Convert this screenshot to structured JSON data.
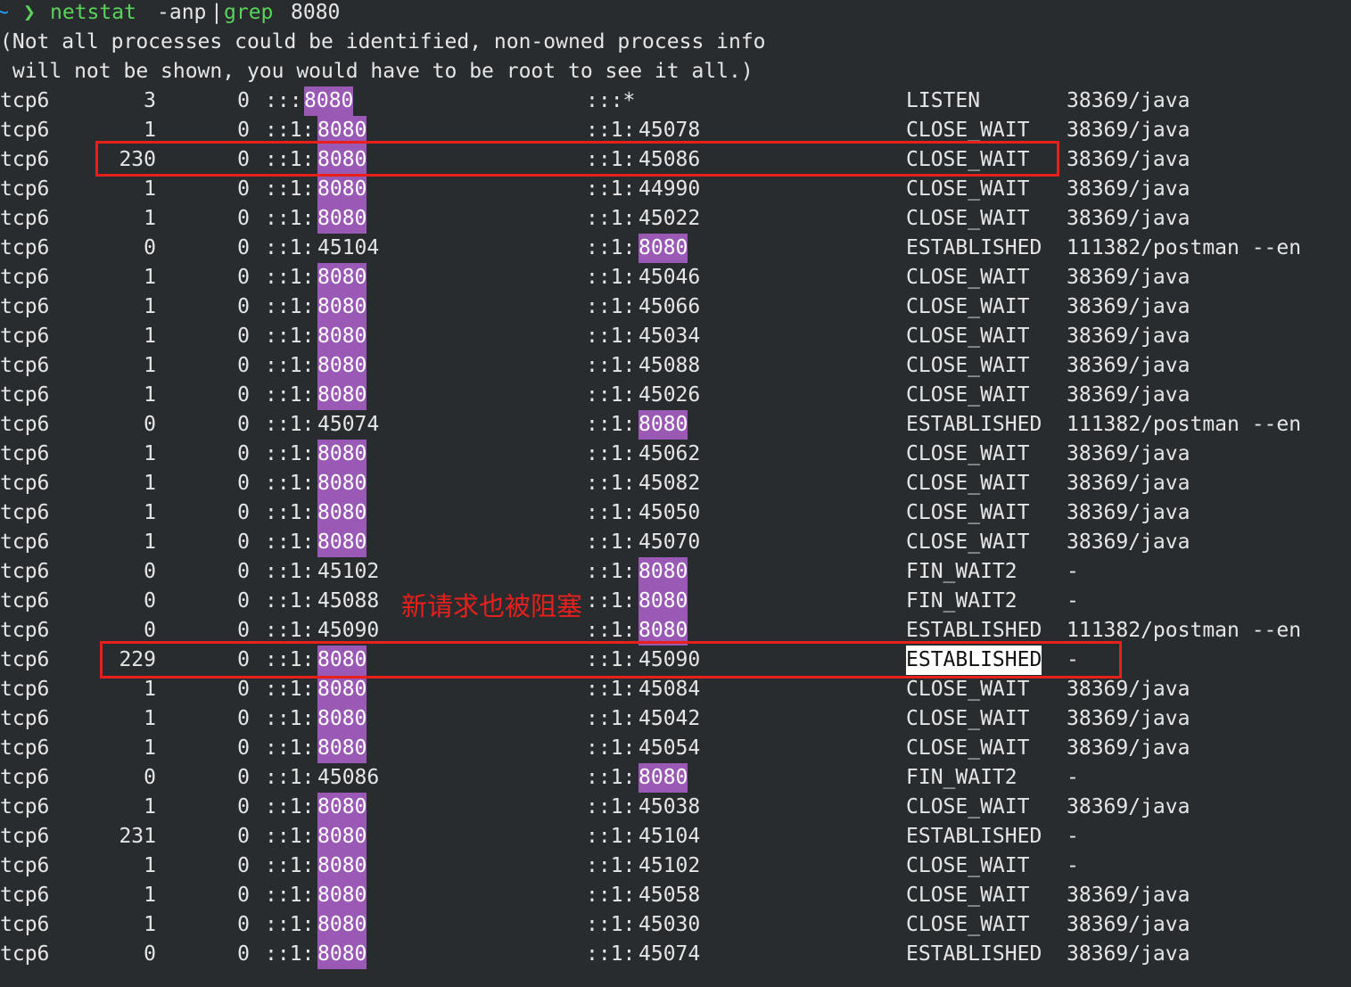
{
  "command": {
    "prompt_icon": "~",
    "prompt_chevron": "❯",
    "cmd": "netstat",
    "args": "-anp",
    "pipe": "|",
    "grep": "grep",
    "pattern": "8080"
  },
  "warning": [
    "(Not all processes could be identified, non-owned process info",
    " will not be shown, you would have to be root to see it all.)"
  ],
  "rows": [
    {
      "proto": "tcp6",
      "recv": "3",
      "send": "0",
      "local_prefix": ":::",
      "local_port": "8080",
      "local_hl": true,
      "foreign_prefix": ":::*",
      "foreign_port": "",
      "foreign_hl": false,
      "state": "LISTEN",
      "pid": "38369/java"
    },
    {
      "proto": "tcp6",
      "recv": "1",
      "send": "0",
      "local_prefix": "::1:",
      "local_port": "8080",
      "local_hl": true,
      "foreign_prefix": "::1:",
      "foreign_port": "45078",
      "foreign_hl": false,
      "state": "CLOSE_WAIT",
      "pid": "38369/java"
    },
    {
      "proto": "tcp6",
      "recv": "230",
      "send": "0",
      "local_prefix": "::1:",
      "local_port": "8080",
      "local_hl": true,
      "foreign_prefix": "::1:",
      "foreign_port": "45086",
      "foreign_hl": false,
      "state": "CLOSE_WAIT",
      "pid": "38369/java"
    },
    {
      "proto": "tcp6",
      "recv": "1",
      "send": "0",
      "local_prefix": "::1:",
      "local_port": "8080",
      "local_hl": true,
      "foreign_prefix": "::1:",
      "foreign_port": "44990",
      "foreign_hl": false,
      "state": "CLOSE_WAIT",
      "pid": "38369/java"
    },
    {
      "proto": "tcp6",
      "recv": "1",
      "send": "0",
      "local_prefix": "::1:",
      "local_port": "8080",
      "local_hl": true,
      "foreign_prefix": "::1:",
      "foreign_port": "45022",
      "foreign_hl": false,
      "state": "CLOSE_WAIT",
      "pid": "38369/java"
    },
    {
      "proto": "tcp6",
      "recv": "0",
      "send": "0",
      "local_prefix": "::1:",
      "local_port": "45104",
      "local_hl": false,
      "foreign_prefix": "::1:",
      "foreign_port": "8080",
      "foreign_hl": true,
      "state": "ESTABLISHED",
      "pid": "111382/postman --en"
    },
    {
      "proto": "tcp6",
      "recv": "1",
      "send": "0",
      "local_prefix": "::1:",
      "local_port": "8080",
      "local_hl": true,
      "foreign_prefix": "::1:",
      "foreign_port": "45046",
      "foreign_hl": false,
      "state": "CLOSE_WAIT",
      "pid": "38369/java"
    },
    {
      "proto": "tcp6",
      "recv": "1",
      "send": "0",
      "local_prefix": "::1:",
      "local_port": "8080",
      "local_hl": true,
      "foreign_prefix": "::1:",
      "foreign_port": "45066",
      "foreign_hl": false,
      "state": "CLOSE_WAIT",
      "pid": "38369/java"
    },
    {
      "proto": "tcp6",
      "recv": "1",
      "send": "0",
      "local_prefix": "::1:",
      "local_port": "8080",
      "local_hl": true,
      "foreign_prefix": "::1:",
      "foreign_port": "45034",
      "foreign_hl": false,
      "state": "CLOSE_WAIT",
      "pid": "38369/java"
    },
    {
      "proto": "tcp6",
      "recv": "1",
      "send": "0",
      "local_prefix": "::1:",
      "local_port": "8080",
      "local_hl": true,
      "foreign_prefix": "::1:",
      "foreign_port": "45088",
      "foreign_hl": false,
      "state": "CLOSE_WAIT",
      "pid": "38369/java"
    },
    {
      "proto": "tcp6",
      "recv": "1",
      "send": "0",
      "local_prefix": "::1:",
      "local_port": "8080",
      "local_hl": true,
      "foreign_prefix": "::1:",
      "foreign_port": "45026",
      "foreign_hl": false,
      "state": "CLOSE_WAIT",
      "pid": "38369/java"
    },
    {
      "proto": "tcp6",
      "recv": "0",
      "send": "0",
      "local_prefix": "::1:",
      "local_port": "45074",
      "local_hl": false,
      "foreign_prefix": "::1:",
      "foreign_port": "8080",
      "foreign_hl": true,
      "state": "ESTABLISHED",
      "pid": "111382/postman --en"
    },
    {
      "proto": "tcp6",
      "recv": "1",
      "send": "0",
      "local_prefix": "::1:",
      "local_port": "8080",
      "local_hl": true,
      "foreign_prefix": "::1:",
      "foreign_port": "45062",
      "foreign_hl": false,
      "state": "CLOSE_WAIT",
      "pid": "38369/java"
    },
    {
      "proto": "tcp6",
      "recv": "1",
      "send": "0",
      "local_prefix": "::1:",
      "local_port": "8080",
      "local_hl": true,
      "foreign_prefix": "::1:",
      "foreign_port": "45082",
      "foreign_hl": false,
      "state": "CLOSE_WAIT",
      "pid": "38369/java"
    },
    {
      "proto": "tcp6",
      "recv": "1",
      "send": "0",
      "local_prefix": "::1:",
      "local_port": "8080",
      "local_hl": true,
      "foreign_prefix": "::1:",
      "foreign_port": "45050",
      "foreign_hl": false,
      "state": "CLOSE_WAIT",
      "pid": "38369/java"
    },
    {
      "proto": "tcp6",
      "recv": "1",
      "send": "0",
      "local_prefix": "::1:",
      "local_port": "8080",
      "local_hl": true,
      "foreign_prefix": "::1:",
      "foreign_port": "45070",
      "foreign_hl": false,
      "state": "CLOSE_WAIT",
      "pid": "38369/java"
    },
    {
      "proto": "tcp6",
      "recv": "0",
      "send": "0",
      "local_prefix": "::1:",
      "local_port": "45102",
      "local_hl": false,
      "foreign_prefix": "::1:",
      "foreign_port": "8080",
      "foreign_hl": true,
      "state": "FIN_WAIT2",
      "pid": "-"
    },
    {
      "proto": "tcp6",
      "recv": "0",
      "send": "0",
      "local_prefix": "::1:",
      "local_port": "45088",
      "local_hl": false,
      "foreign_prefix": "::1:",
      "foreign_port": "8080",
      "foreign_hl": true,
      "state": "FIN_WAIT2",
      "pid": "-"
    },
    {
      "proto": "tcp6",
      "recv": "0",
      "send": "0",
      "local_prefix": "::1:",
      "local_port": "45090",
      "local_hl": false,
      "foreign_prefix": "::1:",
      "foreign_port": "8080",
      "foreign_hl": true,
      "state": "ESTABLISHED",
      "pid": "111382/postman --en"
    },
    {
      "proto": "tcp6",
      "recv": "229",
      "send": "0",
      "local_prefix": "::1:",
      "local_port": "8080",
      "local_hl": true,
      "foreign_prefix": "::1:",
      "foreign_port": "45090",
      "foreign_hl": false,
      "state": "ESTABLISHED",
      "pid": "-",
      "state_selected": true
    },
    {
      "proto": "tcp6",
      "recv": "1",
      "send": "0",
      "local_prefix": "::1:",
      "local_port": "8080",
      "local_hl": true,
      "foreign_prefix": "::1:",
      "foreign_port": "45084",
      "foreign_hl": false,
      "state": "CLOSE_WAIT",
      "pid": "38369/java"
    },
    {
      "proto": "tcp6",
      "recv": "1",
      "send": "0",
      "local_prefix": "::1:",
      "local_port": "8080",
      "local_hl": true,
      "foreign_prefix": "::1:",
      "foreign_port": "45042",
      "foreign_hl": false,
      "state": "CLOSE_WAIT",
      "pid": "38369/java"
    },
    {
      "proto": "tcp6",
      "recv": "1",
      "send": "0",
      "local_prefix": "::1:",
      "local_port": "8080",
      "local_hl": true,
      "foreign_prefix": "::1:",
      "foreign_port": "45054",
      "foreign_hl": false,
      "state": "CLOSE_WAIT",
      "pid": "38369/java"
    },
    {
      "proto": "tcp6",
      "recv": "0",
      "send": "0",
      "local_prefix": "::1:",
      "local_port": "45086",
      "local_hl": false,
      "foreign_prefix": "::1:",
      "foreign_port": "8080",
      "foreign_hl": true,
      "state": "FIN_WAIT2",
      "pid": "-"
    },
    {
      "proto": "tcp6",
      "recv": "1",
      "send": "0",
      "local_prefix": "::1:",
      "local_port": "8080",
      "local_hl": true,
      "foreign_prefix": "::1:",
      "foreign_port": "45038",
      "foreign_hl": false,
      "state": "CLOSE_WAIT",
      "pid": "38369/java"
    },
    {
      "proto": "tcp6",
      "recv": "231",
      "send": "0",
      "local_prefix": "::1:",
      "local_port": "8080",
      "local_hl": true,
      "foreign_prefix": "::1:",
      "foreign_port": "45104",
      "foreign_hl": false,
      "state": "ESTABLISHED",
      "pid": "-"
    },
    {
      "proto": "tcp6",
      "recv": "1",
      "send": "0",
      "local_prefix": "::1:",
      "local_port": "8080",
      "local_hl": true,
      "foreign_prefix": "::1:",
      "foreign_port": "45102",
      "foreign_hl": false,
      "state": "CLOSE_WAIT",
      "pid": "-"
    },
    {
      "proto": "tcp6",
      "recv": "1",
      "send": "0",
      "local_prefix": "::1:",
      "local_port": "8080",
      "local_hl": true,
      "foreign_prefix": "::1:",
      "foreign_port": "45058",
      "foreign_hl": false,
      "state": "CLOSE_WAIT",
      "pid": "38369/java"
    },
    {
      "proto": "tcp6",
      "recv": "1",
      "send": "0",
      "local_prefix": "::1:",
      "local_port": "8080",
      "local_hl": true,
      "foreign_prefix": "::1:",
      "foreign_port": "45030",
      "foreign_hl": false,
      "state": "CLOSE_WAIT",
      "pid": "38369/java"
    },
    {
      "proto": "tcp6",
      "recv": "0",
      "send": "0",
      "local_prefix": "::1:",
      "local_port": "8080",
      "local_hl": true,
      "foreign_prefix": "::1:",
      "foreign_port": "45074",
      "foreign_hl": false,
      "state": "ESTABLISHED",
      "pid": "38369/java"
    }
  ],
  "annotation": "新请求也被阻塞",
  "colors": {
    "background": "#282c2e",
    "text": "#e6e6e6",
    "port_highlight": "#9b59b6",
    "annotation_red": "#e8201c",
    "prompt_blue": "#2aa1ff",
    "command_green": "#5ad35a"
  }
}
